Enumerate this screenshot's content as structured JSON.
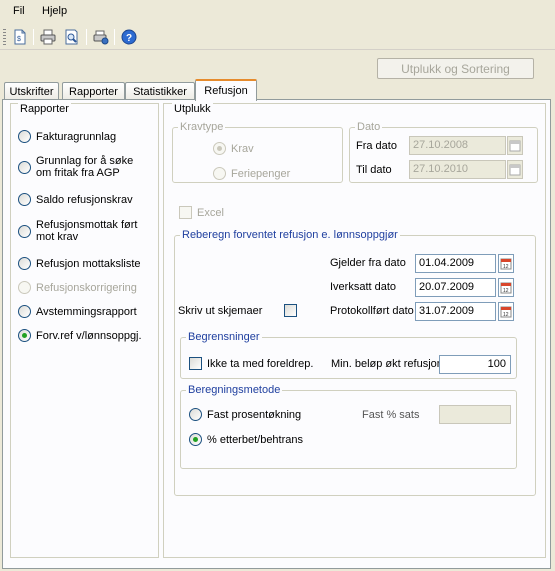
{
  "menu": {
    "file": "Fil",
    "help": "Hjelp"
  },
  "toolbar": {
    "icons": [
      "new-document-icon",
      "print-icon",
      "print-preview-icon",
      "printer-settings-icon",
      "help-icon"
    ]
  },
  "sort_button": "Utplukk og Sortering",
  "tabs": [
    {
      "label": "Utskrifter",
      "active": false
    },
    {
      "label": "Rapporter",
      "active": false
    },
    {
      "label": "Statistikker",
      "active": false
    },
    {
      "label": "Refusjon",
      "active": true
    }
  ],
  "rapporter": {
    "title": "Rapporter",
    "items": [
      {
        "label_lines": [
          "Fakturagrunnlag"
        ],
        "selected": false,
        "disabled": false
      },
      {
        "label_lines": [
          "Grunnlag for å søke",
          "om fritak fra AGP"
        ],
        "selected": false,
        "disabled": false
      },
      {
        "label_lines": [
          "Saldo refusjonskrav"
        ],
        "selected": false,
        "disabled": false
      },
      {
        "label_lines": [
          "Refusjonsmottak ført",
          "mot krav"
        ],
        "selected": false,
        "disabled": false
      },
      {
        "label_lines": [
          "Refusjon mottaksliste"
        ],
        "selected": false,
        "disabled": false
      },
      {
        "label_lines": [
          "Refusjonskorrigering"
        ],
        "selected": false,
        "disabled": true
      },
      {
        "label_lines": [
          "Avstemmingsrapport"
        ],
        "selected": false,
        "disabled": false
      },
      {
        "label_lines": [
          "Forv.ref v/lønnsoppgj."
        ],
        "selected": true,
        "disabled": false
      }
    ]
  },
  "utplukk": {
    "title": "Utplukk",
    "kravtype": {
      "title": "Kravtype",
      "options": [
        {
          "label": "Krav",
          "selected": true
        },
        {
          "label": "Feriepenger",
          "selected": false
        }
      ]
    },
    "dato": {
      "title": "Dato",
      "fra_label": "Fra dato",
      "fra_value": "27.10.2008",
      "til_label": "Til dato",
      "til_value": "27.10.2010"
    },
    "excel": {
      "label": "Excel",
      "checked": false
    }
  },
  "reberegn": {
    "title": "Reberegn forventet refusjon e. lønnsoppgjør",
    "gjelder_label": "Gjelder fra dato",
    "gjelder_value": "01.04.2009",
    "iverksatt_label": "Iverksatt dato",
    "iverksatt_value": "20.07.2009",
    "protokoll_label": "Protokollført dato",
    "protokoll_value": "31.07.2009",
    "skriv_label": "Skriv ut skjemaer",
    "skriv_checked": false,
    "begrensninger": {
      "title": "Begrensninger",
      "ikke_label": "Ikke ta med foreldrep.",
      "ikke_checked": false,
      "min_label": "Min. beløp økt refusjon",
      "min_value": "100"
    },
    "beregningsmetode": {
      "title": "Beregningsmetode",
      "options": [
        {
          "label": "Fast prosentøkning",
          "selected": false
        },
        {
          "label": "% etterbet/behtrans",
          "selected": true
        }
      ],
      "fast_label": "Fast % sats",
      "fast_value": ""
    }
  }
}
